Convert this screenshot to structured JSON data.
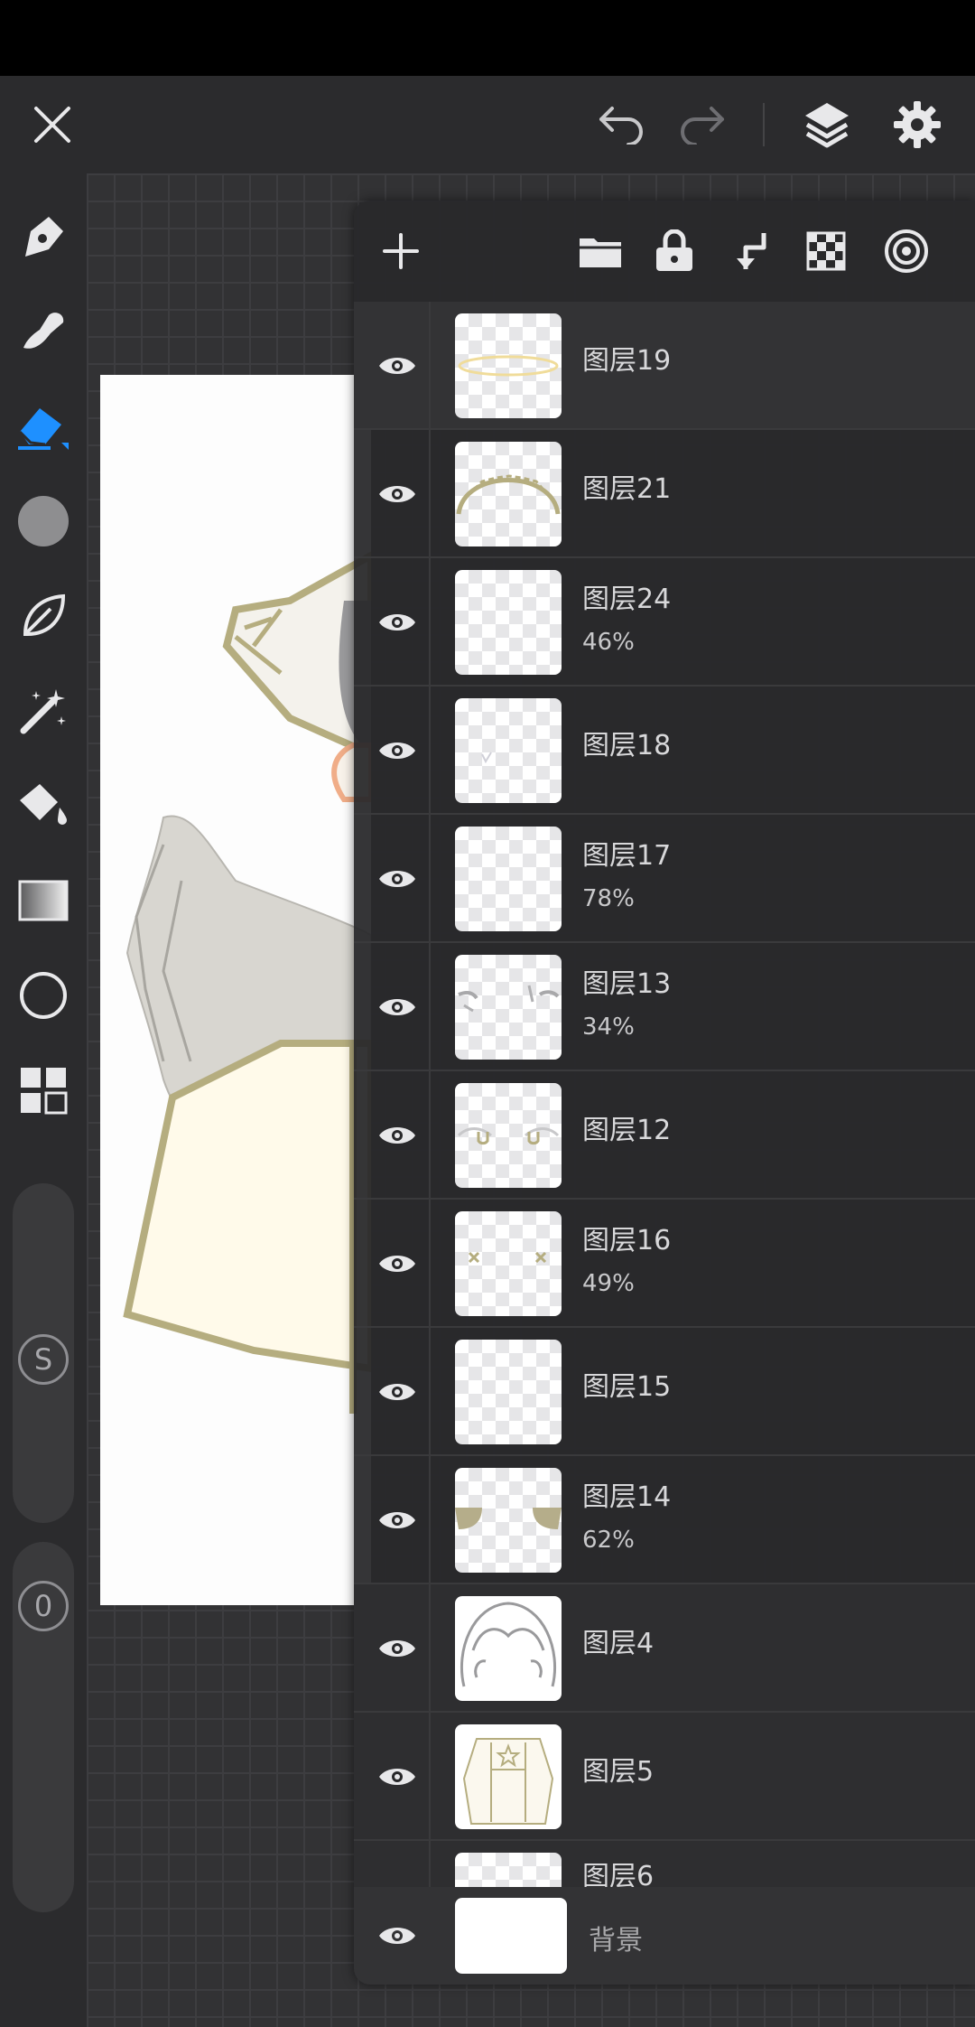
{
  "toolbar_top": {
    "close_icon": "close-icon",
    "undo_icon": "undo-icon",
    "redo_icon": "redo-icon",
    "layers_icon": "layers-icon",
    "settings_icon": "gear-icon"
  },
  "tools": [
    {
      "name": "pen",
      "icon": "pen-icon"
    },
    {
      "name": "smudge",
      "icon": "smudge-icon"
    },
    {
      "name": "eraser",
      "icon": "eraser-icon",
      "active": true
    },
    {
      "name": "color",
      "icon": "color-swatch-icon"
    },
    {
      "name": "brush",
      "icon": "leaf-brush-icon"
    },
    {
      "name": "magic",
      "icon": "magic-wand-icon"
    },
    {
      "name": "fill",
      "icon": "paint-bucket-icon"
    },
    {
      "name": "gradient",
      "icon": "gradient-icon"
    },
    {
      "name": "shape",
      "icon": "circle-shape-icon"
    },
    {
      "name": "more",
      "icon": "grid-tools-icon"
    }
  ],
  "sliders": {
    "size_label": "S",
    "opacity_label": "0"
  },
  "layers_panel": {
    "actions": [
      "add-icon",
      "folder-icon",
      "lock-icon",
      "merge-down-icon",
      "checker-icon",
      "target-icon"
    ],
    "layers": [
      {
        "name": "图层19",
        "opacity": ""
      },
      {
        "name": "图层21",
        "opacity": ""
      },
      {
        "name": "图层24",
        "opacity": "46%"
      },
      {
        "name": "图层18",
        "opacity": ""
      },
      {
        "name": "图层17",
        "opacity": "78%"
      },
      {
        "name": "图层13",
        "opacity": "34%"
      },
      {
        "name": "图层12",
        "opacity": ""
      },
      {
        "name": "图层16",
        "opacity": "49%"
      },
      {
        "name": "图层15",
        "opacity": ""
      },
      {
        "name": "图层14",
        "opacity": "62%"
      },
      {
        "name": "图层4",
        "opacity": ""
      },
      {
        "name": "图层5",
        "opacity": ""
      },
      {
        "name": "图层6",
        "opacity": ""
      }
    ],
    "background_layer": "背景"
  },
  "colors": {
    "accent": "#1e90ff",
    "panel_bg": "#28282a",
    "icon": "#e8e8ea",
    "text": "#d8d8da"
  }
}
